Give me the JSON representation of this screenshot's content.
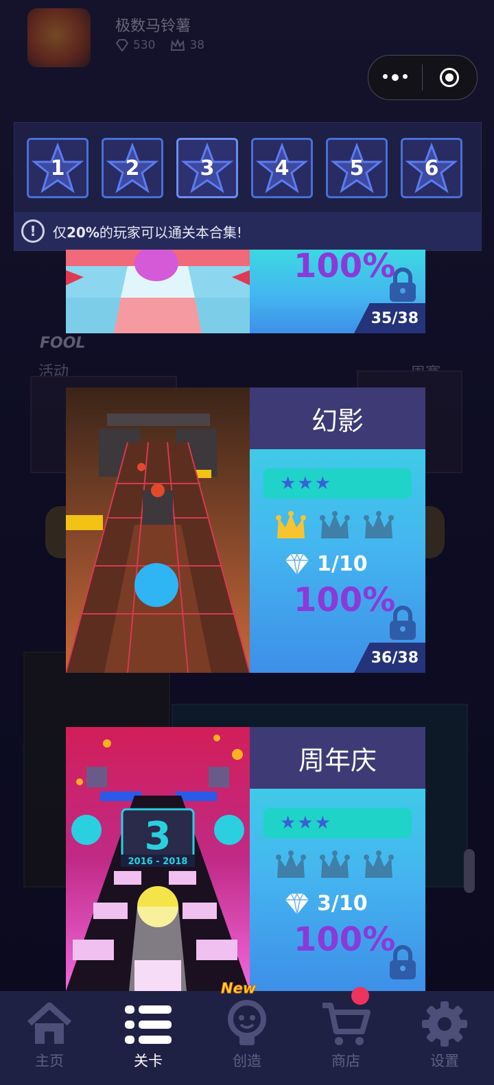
{
  "profile": {
    "name": "极数马铃薯",
    "gems": "530",
    "crowns": "38"
  },
  "background_labels": {
    "left_event": "活动",
    "right_event": "周赛",
    "logo_text": "FOOL"
  },
  "star_selector": {
    "tabs": [
      "1",
      "2",
      "3",
      "4",
      "5",
      "6"
    ],
    "notice_prefix": "仅",
    "notice_percent": "20%",
    "notice_suffix": "的玩家可以通关本合集!"
  },
  "levels": [
    {
      "title": "",
      "rating": "★★★",
      "gems": "",
      "percent": "100%",
      "progress": "35/38",
      "crowns_earned": 0,
      "locked": true
    },
    {
      "title": "幻影",
      "rating": "★★★",
      "gems": "1/10",
      "percent": "100%",
      "progress": "36/38",
      "crowns_earned": 1,
      "locked": true
    },
    {
      "title": "周年庆",
      "rating": "★★★",
      "gems": "3/10",
      "percent": "100%",
      "progress": "",
      "crowns_earned": 0,
      "locked": true,
      "art_text": "2016 - 2018",
      "art_number": "3"
    }
  ],
  "nav": {
    "items": [
      {
        "label": "主页",
        "icon": "home-icon"
      },
      {
        "label": "关卡",
        "icon": "list-icon"
      },
      {
        "label": "创造",
        "icon": "bulb-icon"
      },
      {
        "label": "商店",
        "icon": "cart-icon"
      },
      {
        "label": "设置",
        "icon": "gear-icon"
      }
    ],
    "new_badge": "New"
  },
  "colors": {
    "accent_purple": "#8a3ad8",
    "crown_gold": "#f7c430",
    "crown_empty": "#3f7fa8",
    "nav_bg": "#1f2144",
    "badge_red": "#f0335c"
  }
}
